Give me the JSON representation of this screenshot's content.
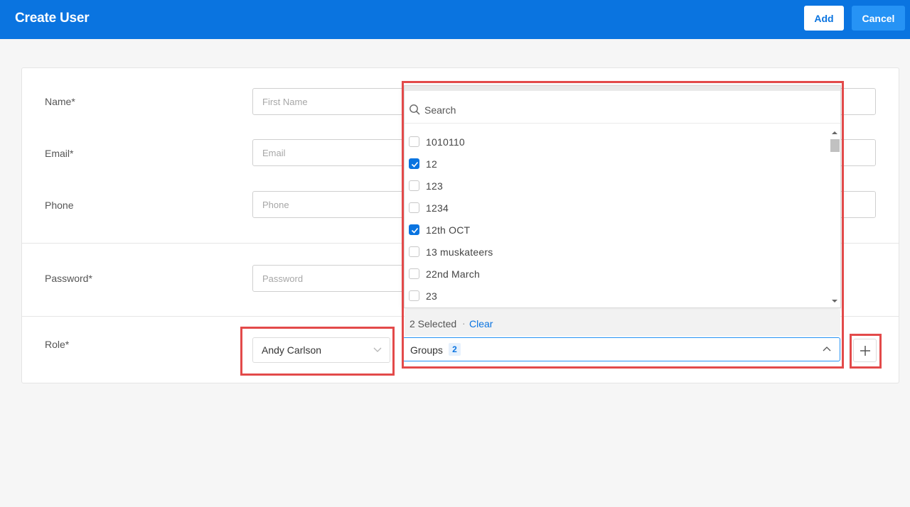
{
  "header": {
    "title": "Create User",
    "add_label": "Add",
    "cancel_label": "Cancel"
  },
  "form": {
    "name_label": "Name*",
    "first_name_placeholder": "First Name",
    "email_label": "Email*",
    "email_placeholder": "Email",
    "phone_label": "Phone",
    "phone_placeholder": "Phone",
    "password_label": "Password*",
    "password_placeholder": "Password",
    "role_label": "Role*",
    "role_value": "Andy Carlson"
  },
  "groups_dropdown": {
    "search_placeholder": "Search",
    "options": [
      {
        "label": "1010110",
        "checked": false
      },
      {
        "label": "12",
        "checked": true
      },
      {
        "label": "123",
        "checked": false
      },
      {
        "label": "1234",
        "checked": false
      },
      {
        "label": "12th OCT",
        "checked": true
      },
      {
        "label": "13 muskateers",
        "checked": false
      },
      {
        "label": "22nd March",
        "checked": false
      },
      {
        "label": "23",
        "checked": false
      }
    ],
    "selected_count_text": "2 Selected",
    "separator": "·",
    "clear_label": "Clear",
    "select_label": "Groups",
    "badge_count": "2"
  },
  "colors": {
    "primary": "#0a74e0",
    "highlight": "#e34a4a"
  }
}
